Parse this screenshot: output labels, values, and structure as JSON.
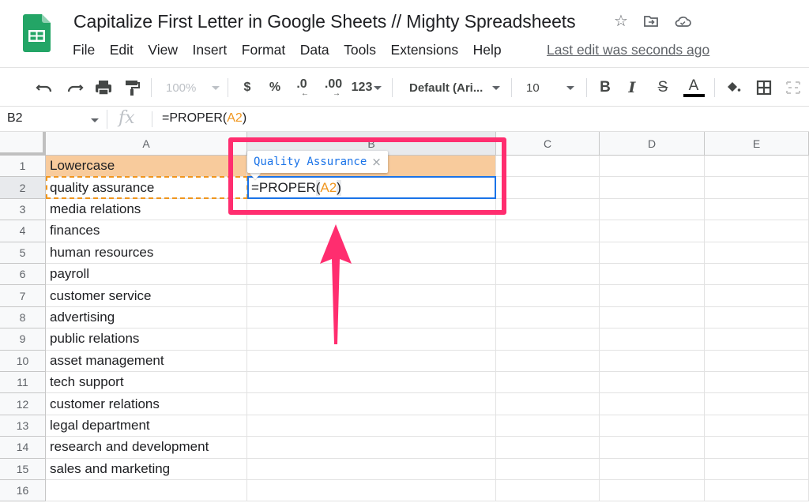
{
  "app": {
    "doc_title": "Capitalize First Letter in Google Sheets // Mighty Spreadsheets",
    "title_icons": [
      "star-icon",
      "move-to-folder-icon",
      "cloud-saved-icon"
    ],
    "menu": [
      "File",
      "Edit",
      "View",
      "Insert",
      "Format",
      "Data",
      "Tools",
      "Extensions",
      "Help"
    ],
    "last_edit": "Last edit was seconds ago"
  },
  "toolbar": {
    "undo": "undo-icon",
    "redo": "redo-icon",
    "print": "print-icon",
    "paint_format": "paint-format-icon",
    "zoom": "100%",
    "currency": "$",
    "percent": "%",
    "decrease_decimal": ".0",
    "increase_decimal": ".00",
    "more_formats": "123",
    "font": "Default (Ari...",
    "font_size": "10",
    "bold": "B",
    "italic": "I",
    "strikethrough": "S",
    "text_color": "A",
    "text_color_value": "#000000"
  },
  "formula_bar": {
    "name_box": "B2",
    "fx": "fx",
    "formula_prefix": "=PROPER(",
    "formula_ref": "A2",
    "formula_suffix": ")"
  },
  "grid": {
    "columns": [
      "A",
      "B",
      "C",
      "D",
      "E"
    ],
    "rows": [
      "1",
      "2",
      "3",
      "4",
      "5",
      "6",
      "7",
      "8",
      "9",
      "10",
      "11",
      "12",
      "13",
      "14",
      "15",
      "16"
    ],
    "column_a": [
      "Lowercase",
      "quality assurance",
      "media relations",
      "finances",
      "human resources",
      "payroll",
      "customer service",
      "advertising",
      "public relations",
      "asset management",
      "tech support",
      "customer relations",
      "legal department",
      "research and development",
      "sales and marketing",
      ""
    ],
    "active_cell": "B2",
    "edit_prefix": "=PROPER",
    "edit_open": "(",
    "edit_ref": "A2",
    "edit_close": ")",
    "preview_tooltip": "Quality Assurance",
    "preview_close": "×"
  },
  "colors": {
    "header_fill": "#f8cb9c",
    "annotation": "#ff2d6f",
    "reference": "#f0961e",
    "active_border": "#1a73e8",
    "logo_green": "#23a566"
  }
}
